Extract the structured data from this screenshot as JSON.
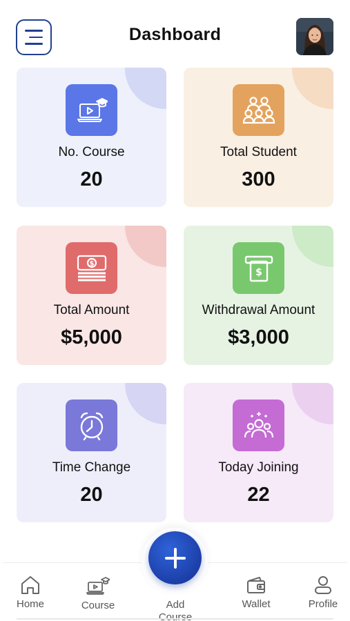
{
  "header": {
    "title": "Dashboard",
    "menu_icon": "hamburger-menu-icon",
    "avatar_icon": "user-avatar"
  },
  "cards": [
    {
      "label": "No. Course",
      "value": "20",
      "icon": "course-laptop-icon",
      "accent": "#5b76e6"
    },
    {
      "label": "Total Student",
      "value": "300",
      "icon": "students-group-icon",
      "accent": "#e3a35e"
    },
    {
      "label": "Total Amount",
      "value": "$5,000",
      "icon": "money-stack-icon",
      "accent": "#e06b6b"
    },
    {
      "label": "Withdrawal Amount",
      "value": "$3,000",
      "icon": "atm-withdraw-icon",
      "accent": "#79c86e"
    },
    {
      "label": "Time Change",
      "value": "20",
      "icon": "alarm-clock-icon",
      "accent": "#7a78d9"
    },
    {
      "label": "Today Joining",
      "value": "22",
      "icon": "new-users-icon",
      "accent": "#c46bd4"
    }
  ],
  "bottom_nav": {
    "items": [
      {
        "label": "Home",
        "icon": "home-icon"
      },
      {
        "label": "Course",
        "icon": "course-icon"
      },
      {
        "label": "Add Course",
        "icon": "plus-icon"
      },
      {
        "label": "Wallet",
        "icon": "wallet-icon"
      },
      {
        "label": "Profile",
        "icon": "profile-icon"
      }
    ],
    "fab_color": "#1c3fa8"
  }
}
